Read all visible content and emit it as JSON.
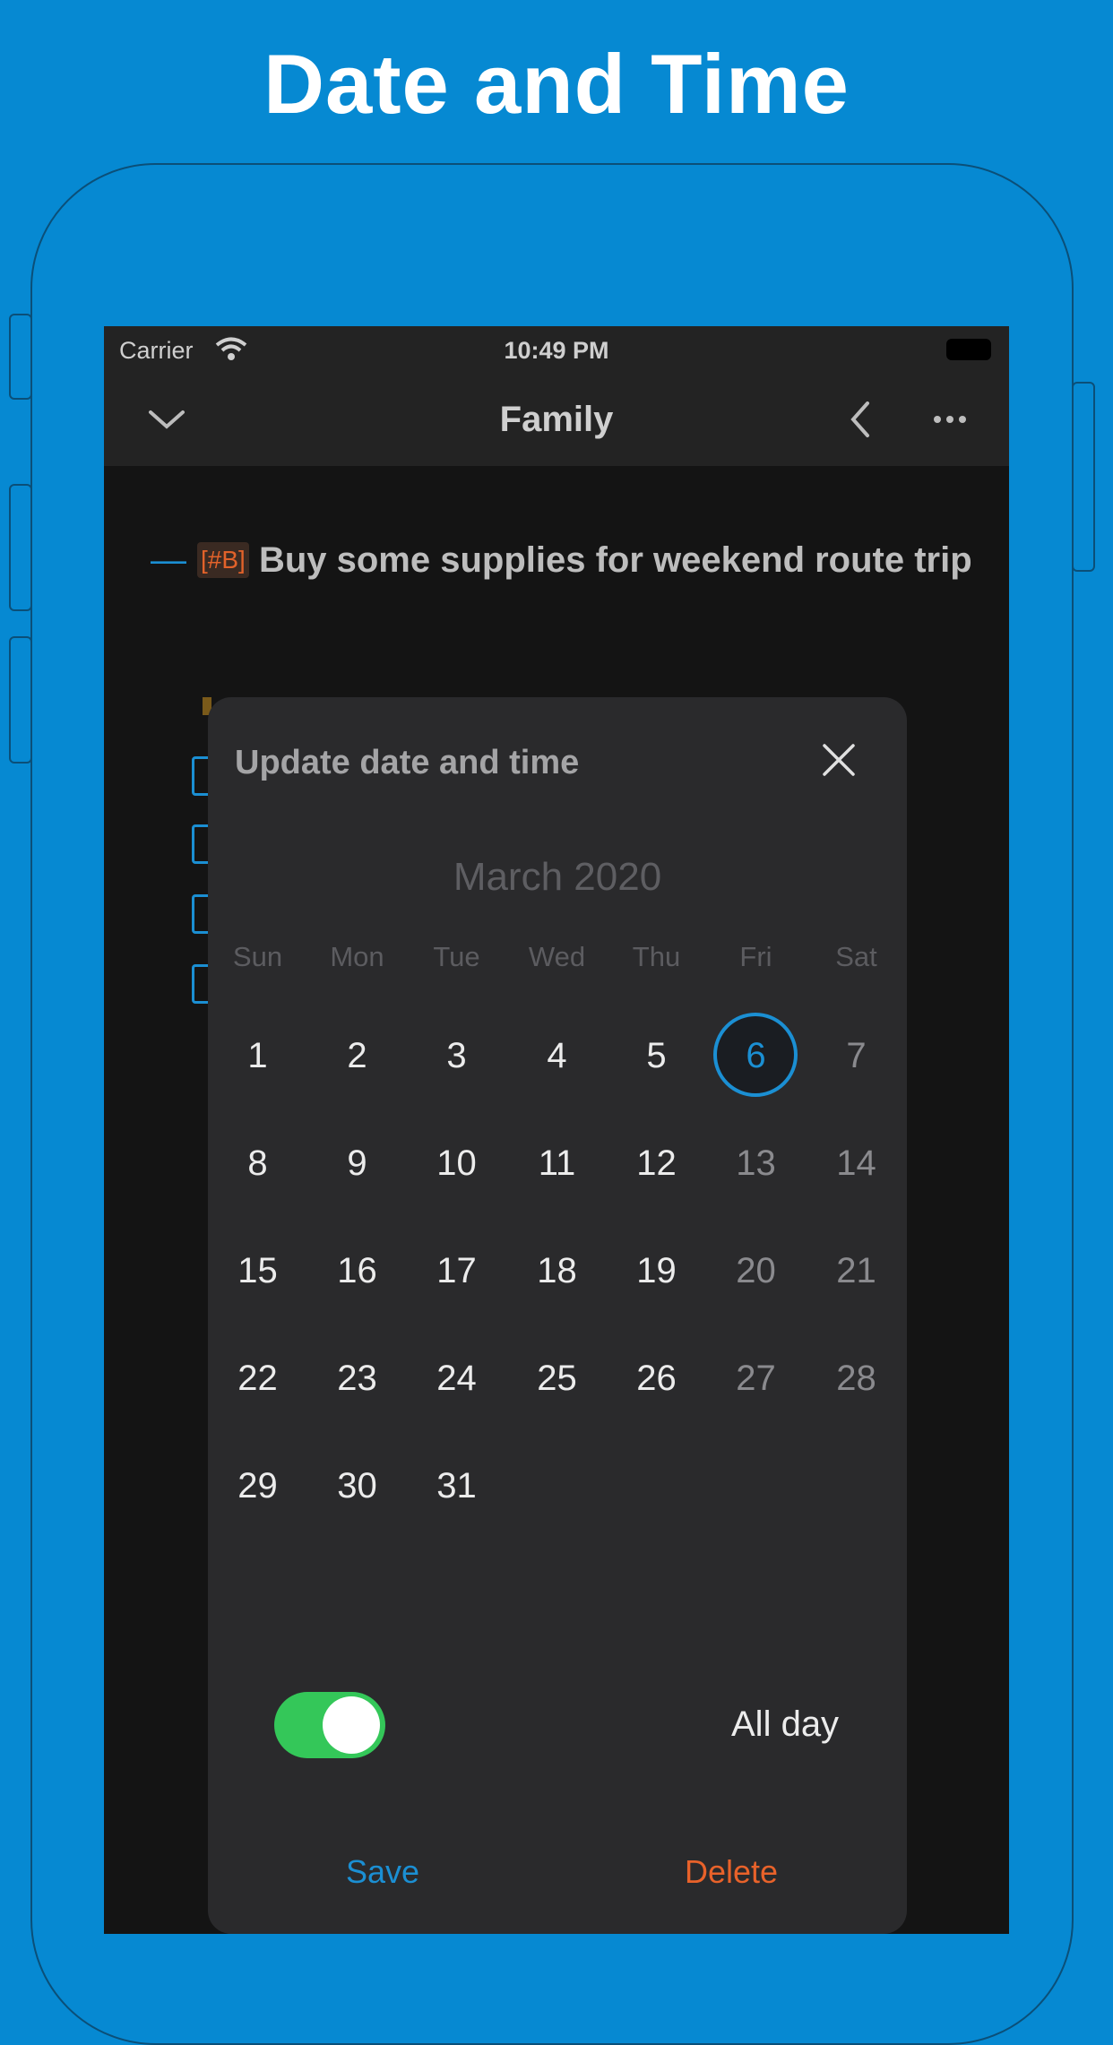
{
  "promo": {
    "title": "Date and Time"
  },
  "status_bar": {
    "carrier": "Carrier",
    "time": "10:49 PM"
  },
  "nav": {
    "title": "Family",
    "icons": [
      "chevron-down-icon",
      "back-icon",
      "more-icon"
    ]
  },
  "task": {
    "tag": "[#B]",
    "text": "Buy some supplies for weekend route trip"
  },
  "dialog": {
    "title": "Update date and time",
    "month": "March 2020",
    "weekdays": [
      "Sun",
      "Mon",
      "Tue",
      "Wed",
      "Thu",
      "Fri",
      "Sat"
    ],
    "weeks": [
      [
        "1",
        "2",
        "3",
        "4",
        "5",
        "6",
        "7"
      ],
      [
        "8",
        "9",
        "10",
        "11",
        "12",
        "13",
        "14"
      ],
      [
        "15",
        "16",
        "17",
        "18",
        "19",
        "20",
        "21"
      ],
      [
        "22",
        "23",
        "24",
        "25",
        "26",
        "27",
        "28"
      ],
      [
        "29",
        "30",
        "31",
        "",
        "",
        "",
        ""
      ]
    ],
    "selected_day": "6",
    "all_day_label": "All day",
    "all_day_on": true,
    "save_label": "Save",
    "delete_label": "Delete"
  },
  "colors": {
    "background": "#0689d2",
    "accent": "#1b8fd3",
    "delete": "#e8622a",
    "toggle_on": "#34c759"
  }
}
